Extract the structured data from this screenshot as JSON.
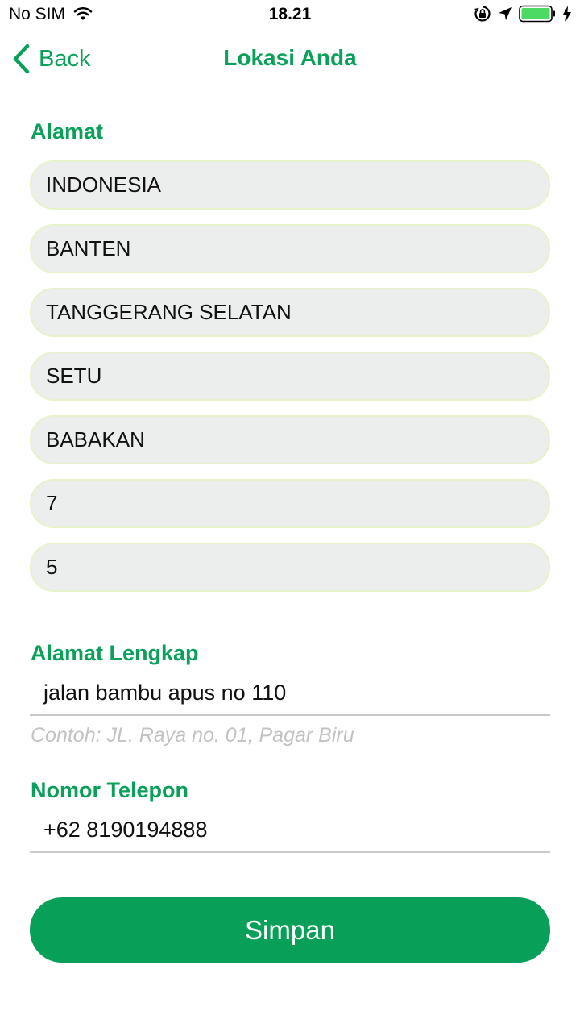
{
  "status_bar": {
    "carrier": "No SIM",
    "time": "18.21",
    "battery_color": "#4cd964"
  },
  "nav": {
    "back_label": "Back",
    "title": "Lokasi Anda",
    "accent_color": "#0aa05a"
  },
  "address": {
    "label": "Alamat",
    "fields": [
      "INDONESIA",
      "BANTEN",
      "TANGGERANG SELATAN",
      "SETU",
      "BABAKAN",
      "7",
      "5"
    ]
  },
  "full_address": {
    "label": "Alamat Lengkap",
    "value": "jalan bambu apus no 110",
    "hint": "Contoh: JL. Raya no. 01, Pagar Biru"
  },
  "phone": {
    "label": "Nomor Telepon",
    "value": "+62 8190194888"
  },
  "save_button": {
    "label": "Simpan",
    "color": "#08a058"
  }
}
